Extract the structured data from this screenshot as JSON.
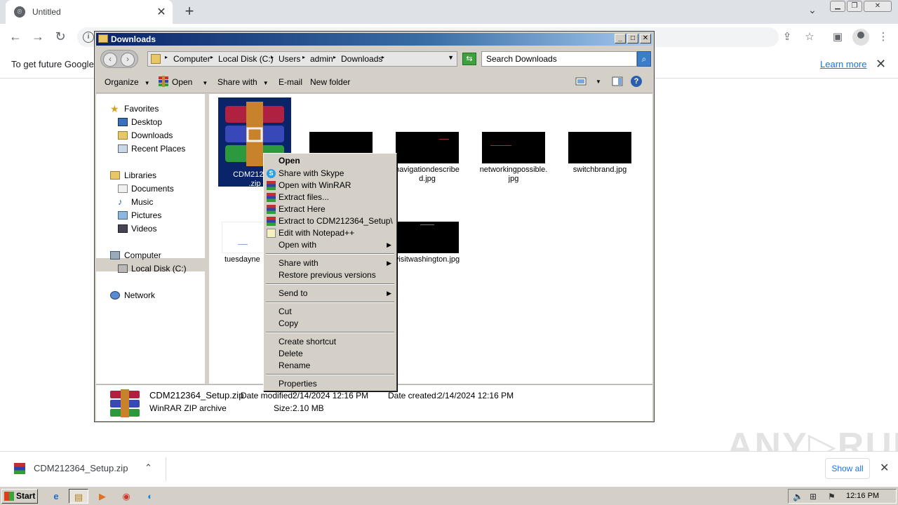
{
  "browser": {
    "tab_title": "Untitled",
    "tab_close": "✕",
    "new_tab": "+",
    "tabs_dropdown": "⌄",
    "window_min": "▁",
    "window_max": "❐",
    "window_close": "✕",
    "nav_back": "←",
    "nav_forward": "→",
    "nav_reload": "↻",
    "info_icon": "i",
    "share_icon": "⇪",
    "star_icon": "☆",
    "sidepanel_icon": "▣",
    "menu_icon": "⋮",
    "infobar": {
      "message": "To get future Google",
      "learn_more": "Learn more",
      "close": "✕"
    }
  },
  "explorer": {
    "title": "Downloads",
    "title_btns": {
      "min": "_",
      "max": "□",
      "close": "✕"
    },
    "back": "‹",
    "forward": "›",
    "breadcrumb": [
      "Computer",
      "Local Disk (C:)",
      "Users",
      "admin",
      "Downloads"
    ],
    "crumb_sep": "▸",
    "addr_dropdown": "▼",
    "refresh_icon": "⇆",
    "search_placeholder": "Search Downloads",
    "search_icon": "⌕",
    "help_icon": "?",
    "views_dropdown": "▼",
    "commands": {
      "organize": "Organize",
      "open": "Open",
      "share_with": "Share with",
      "email": "E-mail",
      "new_folder": "New folder",
      "caret": "▼"
    },
    "nav": {
      "favorites": "Favorites",
      "desktop": "Desktop",
      "downloads": "Downloads",
      "recent": "Recent Places",
      "libraries": "Libraries",
      "documents": "Documents",
      "music": "Music",
      "pictures": "Pictures",
      "videos": "Videos",
      "computer": "Computer",
      "local_disk": "Local Disk (C:)",
      "network": "Network"
    },
    "files": [
      {
        "name": "CDM212364\n.zip"
      },
      {
        "name": ""
      },
      {
        "name": "navigationdescribe\nd.jpg"
      },
      {
        "name": "networkingpossible.\njpg"
      },
      {
        "name": "switchbrand.jpg"
      },
      {
        "name": "tuesdayne"
      },
      {
        "name": "visitwashington.jpg"
      }
    ],
    "details": {
      "filename": "CDM212364_Setup.zip",
      "type": "WinRAR ZIP archive",
      "modified_label": "Date modified:",
      "modified": "2/14/2024 12:16 PM",
      "created_label": "Date created:",
      "created": "2/14/2024 12:16 PM",
      "size_label": "Size:",
      "size": "2.10 MB"
    }
  },
  "context_menu": {
    "open": "Open",
    "share_skype": "Share with Skype",
    "open_winrar": "Open with WinRAR",
    "extract_files": "Extract files...",
    "extract_here": "Extract Here",
    "extract_to": "Extract to CDM212364_Setup\\",
    "edit_notepad": "Edit with Notepad++",
    "open_with": "Open with",
    "share_with": "Share with",
    "restore": "Restore previous versions",
    "send_to": "Send to",
    "cut": "Cut",
    "copy": "Copy",
    "create_shortcut": "Create shortcut",
    "delete": "Delete",
    "rename": "Rename",
    "properties": "Properties",
    "submenu_arrow": "▶"
  },
  "download_bar": {
    "filename": "CDM212364_Setup.zip",
    "caret": "⌃",
    "show_all": "Show all",
    "close": "✕"
  },
  "watermark": "ANY▷RUN",
  "taskbar": {
    "start": "Start",
    "clock": "12:16 PM",
    "ie_icon": "e",
    "explorer_icon": "▤",
    "media_icon": "▶",
    "chrome_icon": "◉",
    "edge_icon": "◐",
    "tray_sound": "🔈",
    "tray_network": "⊞",
    "tray_flag": "⚑"
  },
  "colors": {
    "title_gradient_start": "#0a246a",
    "selection": "#0a246a",
    "link": "#1a73e8",
    "classic_gray": "#d4d0c8"
  }
}
